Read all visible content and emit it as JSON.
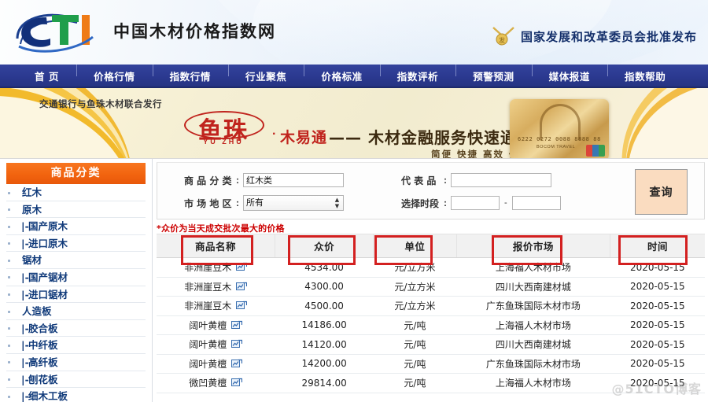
{
  "header": {
    "logo_text": "CTI",
    "site_title": "中国木材价格指数网",
    "gov_approval": "国家发展和改革委员会批准发布"
  },
  "nav": {
    "items": [
      {
        "label": "首  页"
      },
      {
        "label": "价格行情"
      },
      {
        "label": "指数行情"
      },
      {
        "label": "行业聚焦"
      },
      {
        "label": "价格标准"
      },
      {
        "label": "指数评析"
      },
      {
        "label": "预警预测"
      },
      {
        "label": "媒体报道"
      },
      {
        "label": "指数帮助"
      }
    ]
  },
  "banner": {
    "issuer": "交通银行与鱼珠木材联合发行",
    "brand_cn": "鱼珠",
    "brand_pinyin": "YU ZHU",
    "dot": "·",
    "product": "木易通",
    "dash_title": "—— 木材金融服务快速通道",
    "tags": "简便  快捷  高效  低成本",
    "card_number": "6222 0272 0088 8888 88",
    "card_sub": "BOCOM  TRAVEL"
  },
  "sidebar": {
    "title": "商品分类",
    "items": [
      {
        "label": "红木",
        "child": false
      },
      {
        "label": "原木",
        "child": false
      },
      {
        "label": "国产原木",
        "child": true
      },
      {
        "label": "进口原木",
        "child": true
      },
      {
        "label": "锯材",
        "child": false
      },
      {
        "label": "国产锯材",
        "child": true
      },
      {
        "label": "进口锯材",
        "child": true
      },
      {
        "label": "人造板",
        "child": false
      },
      {
        "label": "胶合板",
        "child": true
      },
      {
        "label": "中纤板",
        "child": true
      },
      {
        "label": "高纤板",
        "child": true
      },
      {
        "label": "刨花板",
        "child": true
      },
      {
        "label": "细木工板",
        "child": true
      }
    ],
    "tree_prefix": "|-"
  },
  "search": {
    "category_label": "商 品 分 类",
    "category_value": "红木类",
    "region_label": "市 场 地 区",
    "region_value": "所有",
    "region_options": [
      "所有"
    ],
    "sample_label": "代 表 品",
    "sample_value": "",
    "period_label": "选择时段",
    "period_from": "",
    "period_to": "",
    "period_sep": "-",
    "colon": ":",
    "query_button": "查询"
  },
  "note": "*众价为当天成交批次最大的价格",
  "table": {
    "columns": [
      "商品名称",
      "众价",
      "单位",
      "报价市场",
      "时间"
    ],
    "rows": [
      {
        "name": "非洲崖豆木",
        "price": "4534.00",
        "unit": "元/立方米",
        "market": "上海福人木材市场",
        "date": "2020-05-15"
      },
      {
        "name": "非洲崖豆木",
        "price": "4300.00",
        "unit": "元/立方米",
        "market": "四川大西南建材城",
        "date": "2020-05-15"
      },
      {
        "name": "非洲崖豆木",
        "price": "4500.00",
        "unit": "元/立方米",
        "market": "广东鱼珠国际木材市场",
        "date": "2020-05-15"
      },
      {
        "name": "阔叶黄檀",
        "price": "14186.00",
        "unit": "元/吨",
        "market": "上海福人木材市场",
        "date": "2020-05-15"
      },
      {
        "name": "阔叶黄檀",
        "price": "14120.00",
        "unit": "元/吨",
        "market": "四川大西南建材城",
        "date": "2020-05-15"
      },
      {
        "name": "阔叶黄檀",
        "price": "14200.00",
        "unit": "元/吨",
        "market": "广东鱼珠国际木材市场",
        "date": "2020-05-15"
      },
      {
        "name": "微凹黄檀",
        "price": "29814.00",
        "unit": "元/吨",
        "market": "上海福人木材市场",
        "date": "2020-05-15"
      }
    ]
  },
  "annotations": {
    "color": "#d32020",
    "boxes": [
      "商品名称",
      "众价",
      "单位",
      "报价市场",
      "时间"
    ]
  },
  "watermark": "@51CTO博客",
  "colors": {
    "nav_blue": "#2b3990",
    "sidebar_orange": "#f2640f",
    "brand_red": "#c0231d",
    "query_button": "#fadcc0",
    "annotation_red": "#d32020"
  }
}
